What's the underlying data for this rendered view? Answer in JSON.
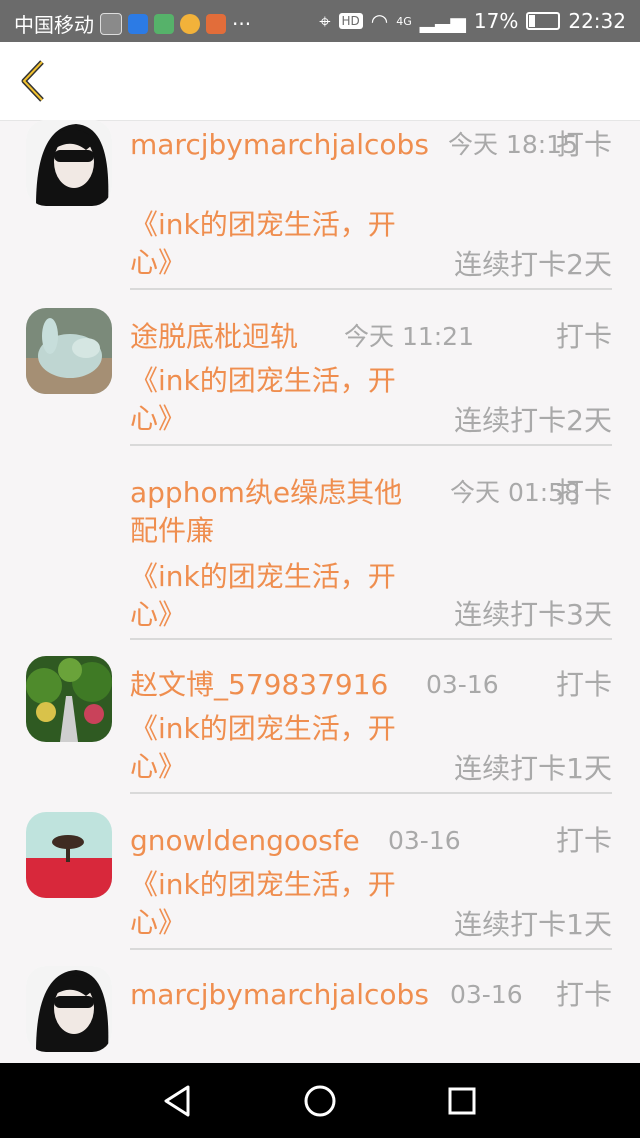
{
  "status_bar": {
    "carrier": "中国移动",
    "signal_label": "4G",
    "battery": "17%",
    "time": "22:32",
    "hd_label": "HD"
  },
  "nav": {
    "back_icon": "chevron-left-icon"
  },
  "items": [
    {
      "name": "marcjbymarchjalcobs",
      "time": "今天 18:15",
      "action": "打卡",
      "group": "《ink的团宠生活，开心》",
      "streak": "连续打卡2天",
      "avatar": "girl-sunglasses"
    },
    {
      "name": "途脱底枇迥轨",
      "time": "今天 11:21",
      "action": "打卡",
      "group": "《ink的团宠生活，开心》",
      "streak": "连续打卡2天",
      "avatar": "rabbit-figurine"
    },
    {
      "name": "apphom纨e缲虑其他配件廉",
      "time": "今天 01:58",
      "action": "打卡",
      "group": "《ink的团宠生活，开心》",
      "streak": "连续打卡3天",
      "avatar": "none"
    },
    {
      "name": "赵文博_579837916",
      "time": "03-16",
      "action": "打卡",
      "group": "《ink的团宠生活，开心》",
      "streak": "连续打卡1天",
      "avatar": "garden-path"
    },
    {
      "name": "gnowldengoosfe",
      "time": "03-16",
      "action": "打卡",
      "group": "《ink的团宠生活，开心》",
      "streak": "连续打卡1天",
      "avatar": "red-field-tree"
    },
    {
      "name": "marcjbymarchjalcobs",
      "time": "03-16",
      "action": "打卡",
      "group": "",
      "streak": "",
      "avatar": "girl-sunglasses"
    }
  ],
  "colors": {
    "accent": "#ef8e4f",
    "muted": "#a9a9a9"
  }
}
